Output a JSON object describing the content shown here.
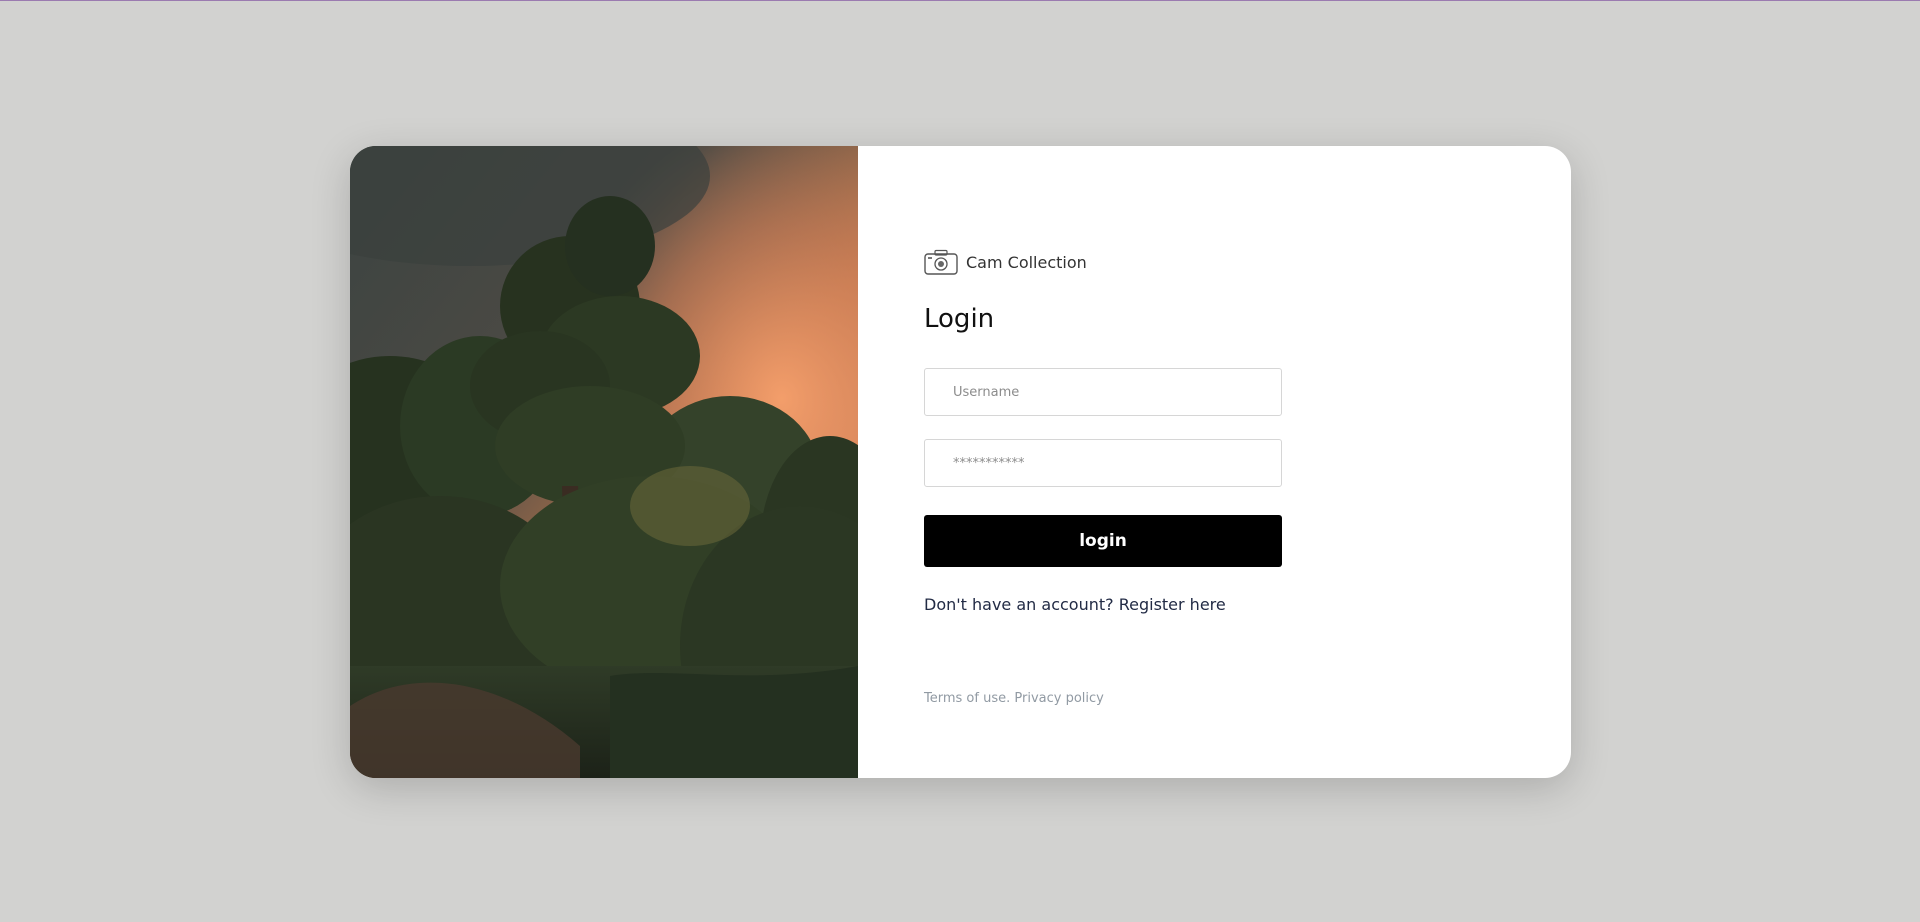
{
  "brand": {
    "name": "Cam Collection",
    "icon": "camera-icon"
  },
  "login": {
    "title": "Login",
    "username_placeholder": "Username",
    "password_placeholder": "***********",
    "button_label": "login"
  },
  "register": {
    "prompt": "Don't have an account?",
    "link_label": "Register here"
  },
  "footer": {
    "terms_label": "Terms of use.",
    "privacy_label": "Privacy policy"
  },
  "colors": {
    "page_background": "#d2d2d0",
    "card_background": "#ffffff",
    "button_background": "#000000",
    "button_text": "#ffffff",
    "link_text": "#222b45",
    "muted_text": "#919aa3"
  }
}
